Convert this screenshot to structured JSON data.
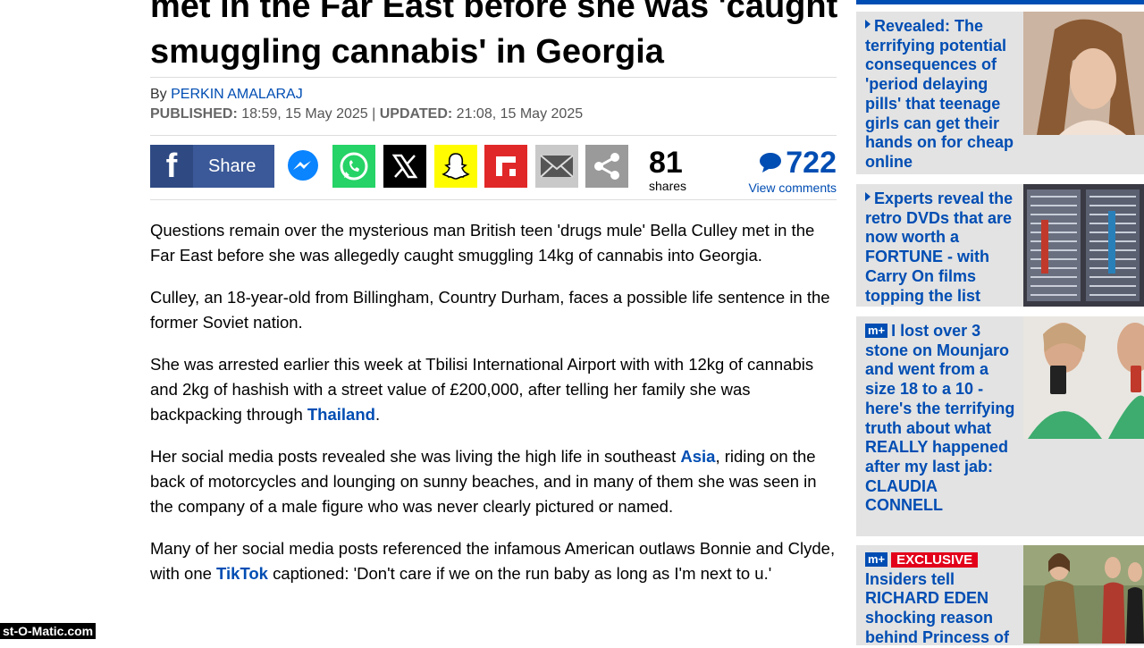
{
  "article": {
    "headline": "met in the Far East before she was 'caught smuggling cannabis' in Georgia",
    "by_prefix": "By",
    "author": "PERKIN AMALARAJ",
    "published_label": "PUBLISHED:",
    "published_value": "18:59, 15 May 2025",
    "divider": "|",
    "updated_label": "UPDATED:",
    "updated_value": "21:08, 15 May 2025"
  },
  "share": {
    "facebook_label": "Share",
    "count": "81",
    "count_label": "shares",
    "comments_count": "722",
    "comments_label": "View comments",
    "buttons": [
      "messenger-icon",
      "whatsapp-icon",
      "x-icon",
      "snapchat-icon",
      "flipboard-icon",
      "email-icon",
      "share-icon"
    ],
    "colors": {
      "facebook": "#3b5998",
      "whatsapp": "#25d366",
      "x": "#000000",
      "snapchat": "#fffc00",
      "flipboard": "#e12828",
      "email": "#bbbbbb",
      "share": "#999999"
    }
  },
  "paragraphs": {
    "p1": "Questions remain over the mysterious man British teen 'drugs mule' Bella Culley met in the Far East before she was allegedly caught smuggling 14kg of cannabis into Georgia.",
    "p2": "Culley, an 18-year-old from Billingham, Country Durham, faces a possible life sentence in the former Soviet nation.",
    "p3_a": "She was arrested earlier this week at Tbilisi International Airport with with 12kg of cannabis and 2kg of hashish with a street value of £200,000, after telling her family she was backpacking through ",
    "p3_link": "Thailand",
    "p3_b": ".",
    "p4_a": "Her social media posts revealed she was living the high life in southeast ",
    "p4_link": "Asia",
    "p4_b": ", riding on the back of motorcycles and lounging on sunny beaches, and in many of them she was seen in the company of a male figure who was never clearly pictured or named.",
    "p5_a": "Many of her social media posts referenced the infamous American outlaws Bonnie and Clyde, with one ",
    "p5_link": "TikTok",
    "p5_b": " captioned: 'Don't care if we on the run baby as long as I'm next to u.'"
  },
  "sidebar": {
    "items": [
      {
        "title": "Revealed: The terrifying potential consequences of 'period delaying pills' that teenage girls can get their hands on for cheap online"
      },
      {
        "title": "Experts reveal the retro DVDs that are now worth a FORTUNE - with Carry On films topping the list"
      },
      {
        "badge": "m+",
        "title": "I lost over 3 stone on Mounjaro and went from a size 18 to a 10 - here's the terrifying truth about what REALLY happened after my last jab: CLAUDIA CONNELL"
      },
      {
        "badge": "m+",
        "exclusive": "EXCLUSIVE",
        "title": "Insiders tell RICHARD EDEN shocking reason behind Princess of"
      }
    ]
  },
  "watermark": "st-O-Matic.com",
  "colors": {
    "link": "#004db3",
    "sidebar_bg": "#e3e3e3",
    "exclusive": "#e2001a"
  }
}
